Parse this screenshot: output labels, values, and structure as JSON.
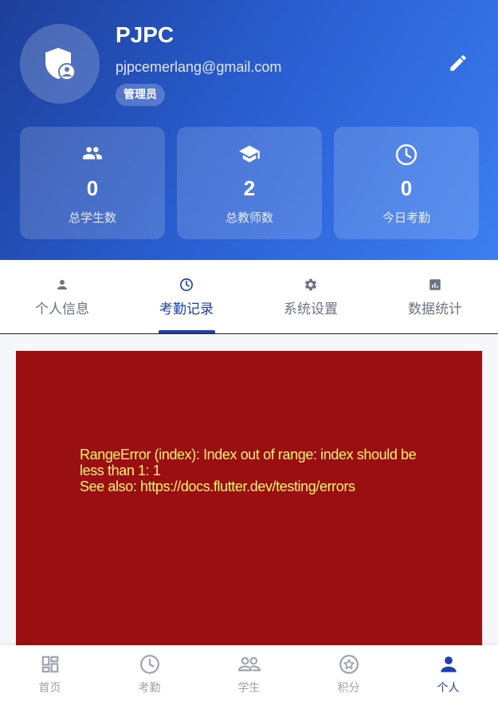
{
  "profile": {
    "name": "PJPC",
    "email": "pjpcemerlang@gmail.com",
    "role": "管理员"
  },
  "stats": [
    {
      "icon": "people-icon",
      "value": "0",
      "label": "总学生数"
    },
    {
      "icon": "school-icon",
      "value": "2",
      "label": "总教师数"
    },
    {
      "icon": "clock-icon",
      "value": "0",
      "label": "今日考勤"
    }
  ],
  "tabs": [
    {
      "icon": "person-icon",
      "label": "个人信息",
      "active": false
    },
    {
      "icon": "clock-icon",
      "label": "考勤记录",
      "active": true
    },
    {
      "icon": "gear-icon",
      "label": "系统设置",
      "active": false
    },
    {
      "icon": "analytics-icon",
      "label": "数据统计",
      "active": false
    }
  ],
  "error": {
    "message": "RangeError (index): Index out of range: index should be\nless than 1: 1\nSee also: https://docs.flutter.dev/testing/errors"
  },
  "bottom_nav": [
    {
      "icon": "dashboard-icon",
      "label": "首页",
      "active": false
    },
    {
      "icon": "clock-icon",
      "label": "考勤",
      "active": false
    },
    {
      "icon": "group-icon",
      "label": "学生",
      "active": false
    },
    {
      "icon": "star-icon",
      "label": "积分",
      "active": false
    },
    {
      "icon": "person-icon",
      "label": "个人",
      "active": true
    }
  ],
  "colors": {
    "primary": "#1e40af",
    "header_start": "#1d3f9a",
    "header_end": "#3c7ef0",
    "error_bg": "#9a1012",
    "error_text": "#fff176",
    "inactive": "#6b7280"
  }
}
